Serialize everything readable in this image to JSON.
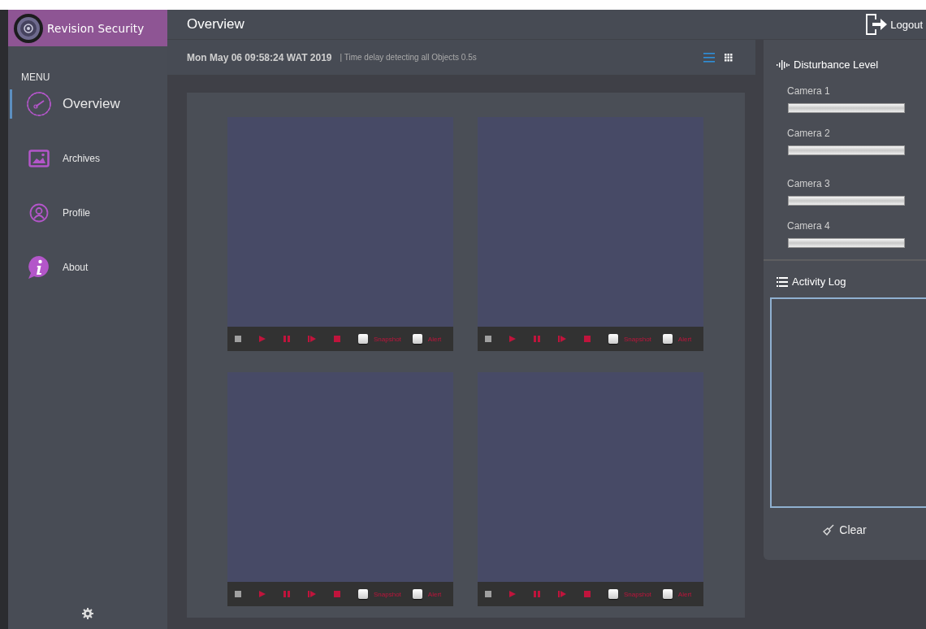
{
  "app": {
    "name": "Revision Security"
  },
  "sidebar": {
    "heading": "MENU",
    "items": [
      {
        "label": "Overview",
        "kind": "gauge",
        "selected": true
      },
      {
        "label": "Archives",
        "kind": "image",
        "selected": false
      },
      {
        "label": "Profile",
        "kind": "user",
        "selected": false
      },
      {
        "label": "About",
        "kind": "info",
        "selected": false
      }
    ]
  },
  "header": {
    "title": "Overview",
    "logout": "Logout"
  },
  "status": {
    "datetime": "Mon May 06 09:58:24 WAT 2019",
    "note": "| Time delay detecting all Objects 0.5s"
  },
  "view_toggle": [
    {
      "kind": "list",
      "selected": true
    },
    {
      "kind": "grid",
      "selected": false
    }
  ],
  "cameras": [
    {
      "snapshot_label": "Snapshot",
      "snapshot_checked": false,
      "alert_label": "Alert",
      "alert_checked": false
    },
    {
      "snapshot_label": "Snapshot",
      "snapshot_checked": false,
      "alert_label": "Alert",
      "alert_checked": false
    },
    {
      "snapshot_label": "Snapshot",
      "snapshot_checked": false,
      "alert_label": "Alert",
      "alert_checked": false
    },
    {
      "snapshot_label": "Snapshot",
      "snapshot_checked": false,
      "alert_label": "Alert",
      "alert_checked": false
    }
  ],
  "disturbance": {
    "title": "Disturbance Level",
    "meters": [
      {
        "name": "Camera 1"
      },
      {
        "name": "Camera 2"
      },
      {
        "name": "Camera 3"
      },
      {
        "name": "Camera 4"
      }
    ]
  },
  "activity_log": {
    "title": "Activity Log",
    "clear": "Clear"
  }
}
